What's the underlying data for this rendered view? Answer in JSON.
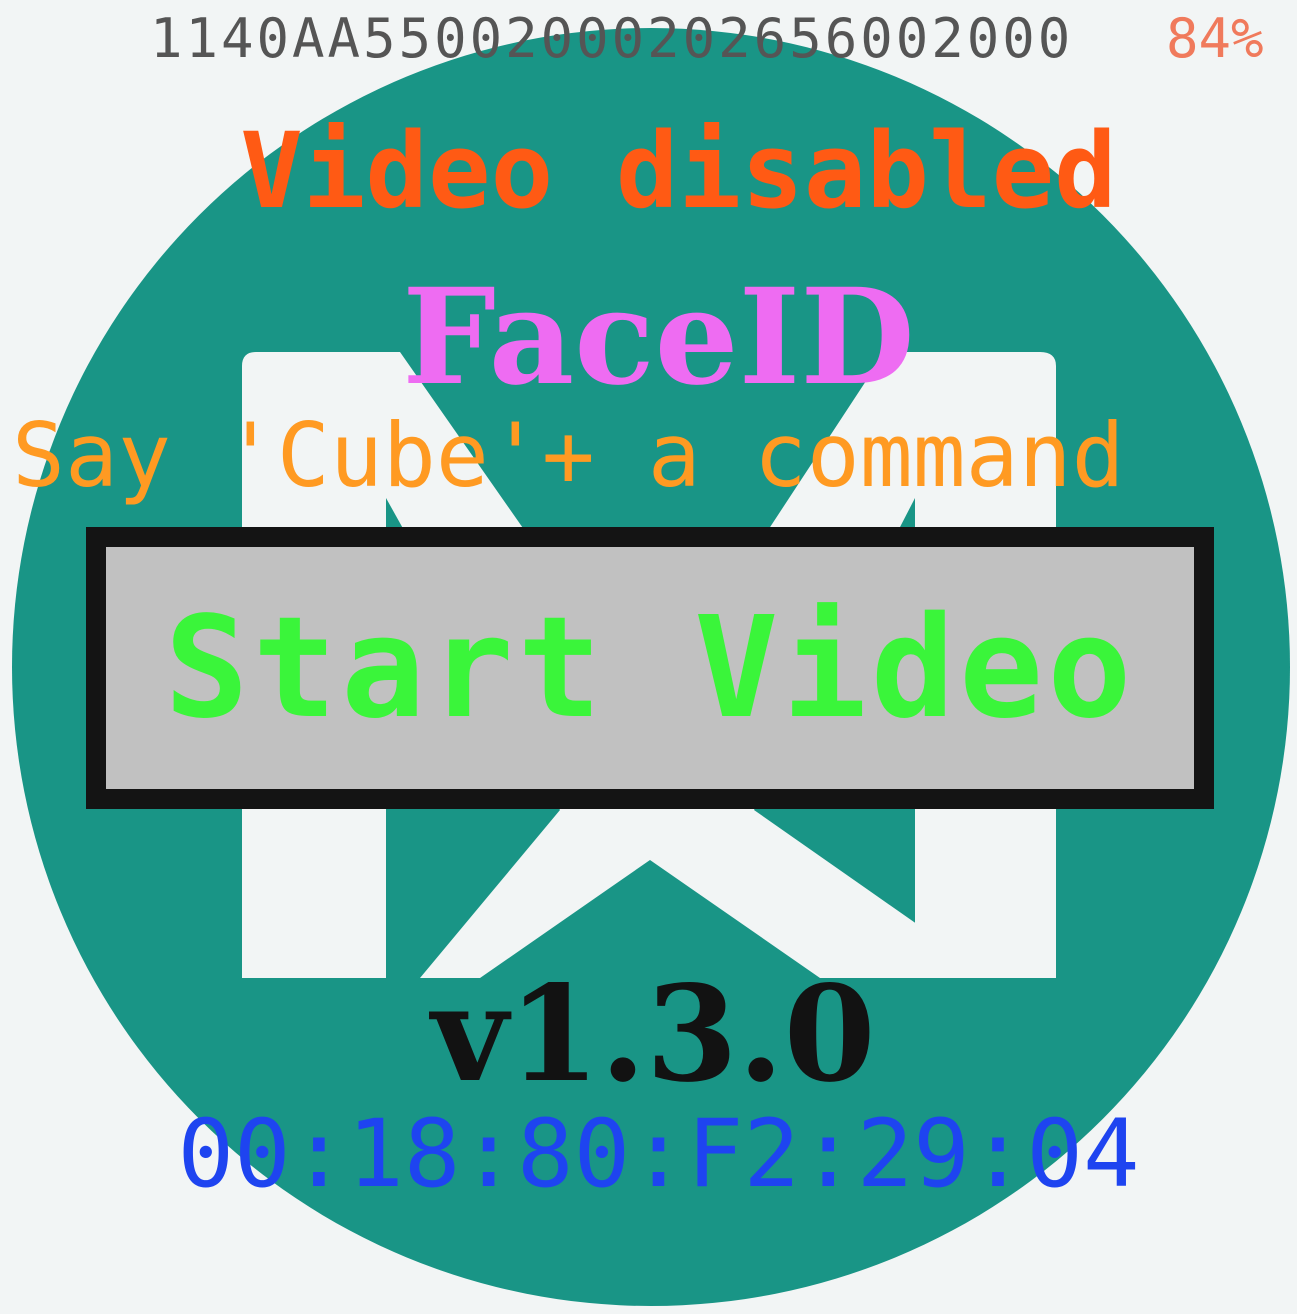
{
  "status_bar": {
    "device_code": "1140AA55002000202656002000",
    "battery": "84%"
  },
  "video_status": "Video disabled",
  "app_title": "FaceID",
  "voice_hint": "Say 'Cube'+ a command",
  "start_button": {
    "label": "Start Video"
  },
  "version": "v1.3.0",
  "mac_address": "00:18:80:F2:29:04",
  "logo": {
    "icon": "nxp-x-logo-icon",
    "circle_color": "#199586",
    "mark_color": "#f2f5f5"
  },
  "colors": {
    "video_status": "#ff5a14",
    "app_title": "#ee6cf2",
    "voice_hint": "#ff9a22",
    "start_label": "#3af53a",
    "button_bg": "#c1c1c1",
    "mac_address": "#1e44f0",
    "battery": "#f07a5c"
  }
}
